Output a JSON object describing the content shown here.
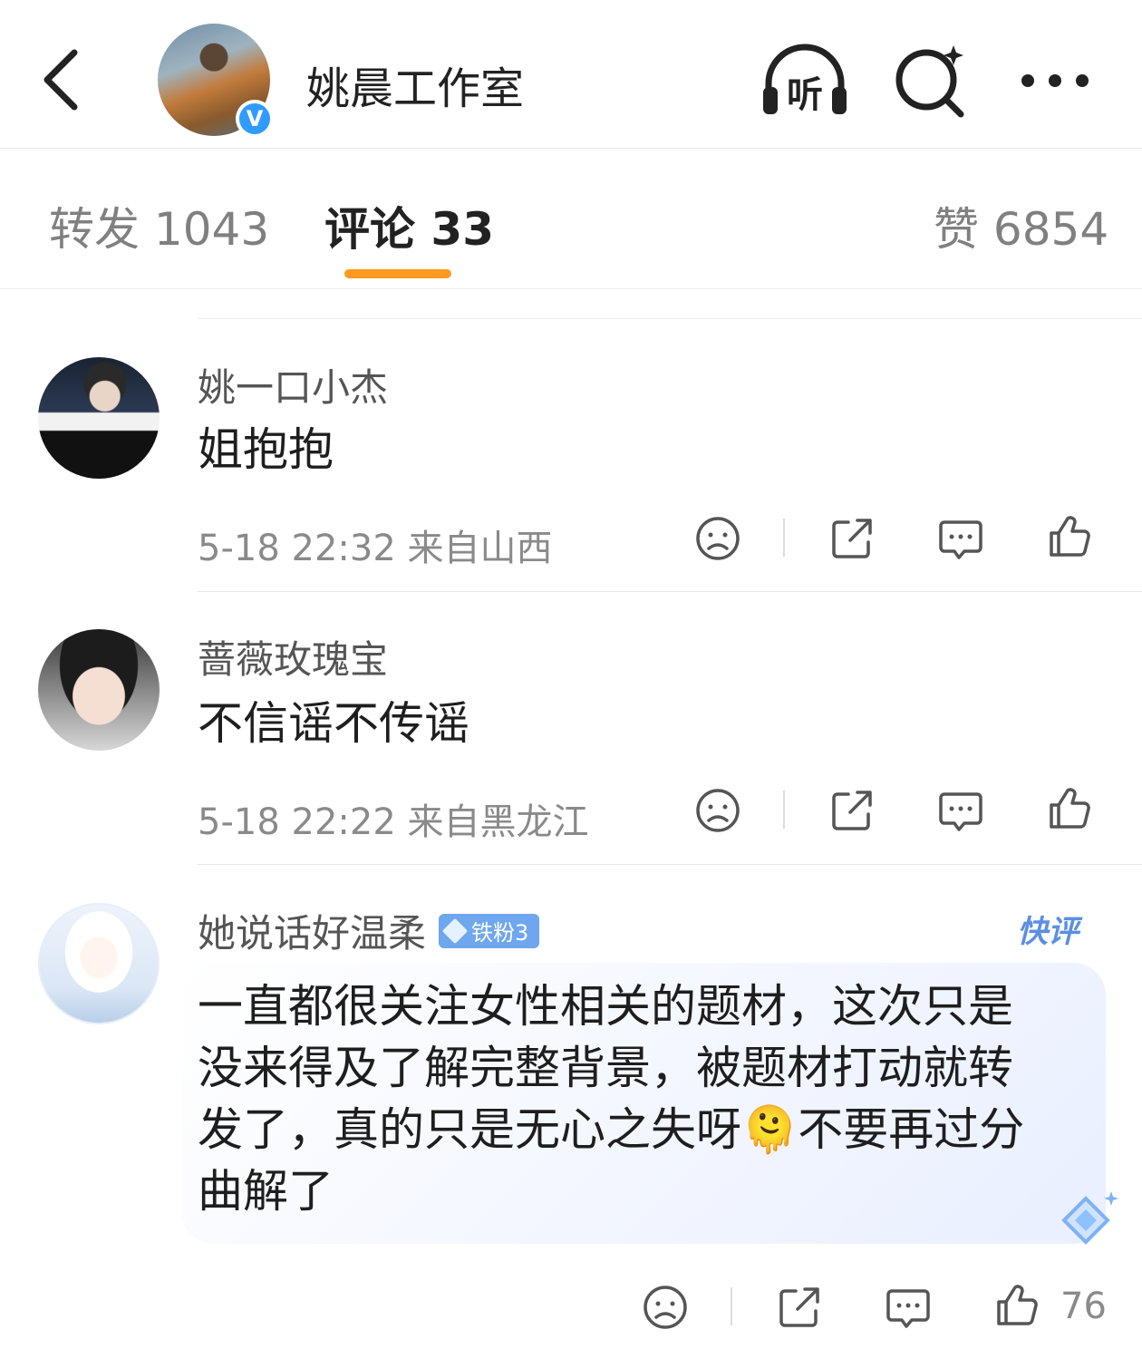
{
  "header": {
    "title": "姚晨工作室",
    "listen_label": "听"
  },
  "tabs": [
    {
      "label": "转发 1043"
    },
    {
      "label": "评论 33"
    },
    {
      "label": "赞 6854"
    }
  ],
  "comments": [
    {
      "username": "姚一口小杰",
      "text": "姐抱抱",
      "meta": "5-18 22:32  来自山西"
    },
    {
      "username": "蔷薇玫瑰宝",
      "text": "不信谣不传谣",
      "meta": "5-18 22:22  来自黑龙江"
    },
    {
      "username": "她说话好温柔",
      "badge": "铁粉3",
      "tag": "快评",
      "lines": [
        "一直都很关注女性相关的题材，这次只是",
        "没来得及了解完整背景，被题材打动就转",
        "发了，真的只是无心之失呀🫠不要再过分",
        "曲解了"
      ],
      "like_count": "76"
    }
  ],
  "colors": {
    "accent": "#ff9a1f",
    "verified": "#2f9bff",
    "badge": "#6ea7ee",
    "quick_tag": "#5b8fe3"
  }
}
